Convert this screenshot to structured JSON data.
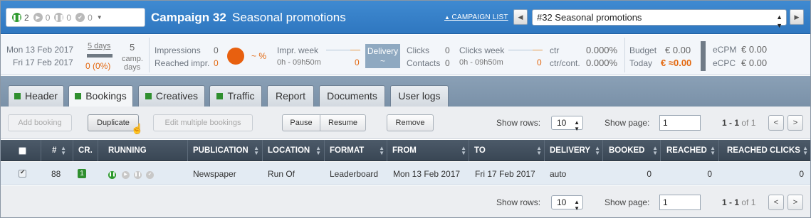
{
  "header": {
    "status_counts": [
      "2",
      "0",
      "0",
      "0"
    ],
    "title": "Campaign 32",
    "subtitle": "Seasonal promotions",
    "campaign_list_link": "CAMPAIGN LIST",
    "campaign_select": "#32 Seasonal promotions",
    "icons": {
      "running": "pause-icon",
      "play": "play-icon",
      "paused": "pause-icon",
      "done": "check-icon",
      "prev": "chevron-left-icon",
      "next": "chevron-right-icon"
    }
  },
  "info": {
    "start_date": "Mon 13 Feb 2017",
    "end_date": "Fri 17 Feb 2017",
    "days_label": "5 days",
    "days_progress": "0 (0%)",
    "camp_days_value": "5",
    "camp_days_label1": "camp.",
    "camp_days_label2": "days",
    "impressions_label": "Impressions",
    "impressions_value": "0",
    "reached_label": "Reached impr.",
    "reached_value": "0",
    "pct": "~ %",
    "impr_week_label": "Impr. week",
    "impr_week_range": "0h - 09h50m",
    "impr_week_value": "0",
    "delivery_label": "Delivery",
    "delivery_value": "~",
    "clicks_label": "Clicks",
    "clicks_value": "0",
    "contacts_label": "Contacts",
    "contacts_value": "0",
    "clicks_week_label": "Clicks week",
    "clicks_week_range": "0h - 09h50m",
    "clicks_week_value": "0",
    "ctr_label": "ctr",
    "ctr_value": "0.000%",
    "ctrcont_label": "ctr/cont.",
    "ctrcont_value": "0.000%",
    "budget_label": "Budget",
    "budget_value": "€ 0.00",
    "today_label": "Today",
    "today_value": "€ ≈0.00",
    "ecpm_label": "eCPM",
    "ecpm_value": "€ 0.00",
    "ecpc_label": "eCPC",
    "ecpc_value": "€ 0.00"
  },
  "tabs": [
    "Header",
    "Bookings",
    "Creatives",
    "Traffic",
    "Report",
    "Documents",
    "User logs"
  ],
  "toolbar": {
    "add_booking": "Add booking",
    "duplicate": "Duplicate",
    "edit_multiple": "Edit multiple bookings",
    "pause": "Pause",
    "resume": "Resume",
    "remove": "Remove",
    "show_rows_label": "Show rows:",
    "show_rows_value": "10",
    "show_page_label": "Show page:",
    "show_page_value": "1",
    "page_info_range": "1 - 1",
    "page_info_of": "of",
    "page_info_total": "1",
    "prev": "<",
    "next": ">"
  },
  "table": {
    "headers": [
      "#",
      "CR.",
      "RUNNING",
      "PUBLICATION",
      "LOCATION",
      "FORMAT",
      "FROM",
      "TO",
      "DELIVERY",
      "BOOKED",
      "REACHED",
      "REACHED CLICKS"
    ],
    "rows": [
      {
        "id": "88",
        "cr": "1",
        "publication": "Newspaper",
        "location": "Run Of",
        "format": "Leaderboard",
        "from": "Mon 13 Feb 2017",
        "to": "Fri 17 Feb 2017",
        "delivery": "auto",
        "booked": "0",
        "reached": "0",
        "reached_clicks": "0"
      }
    ]
  },
  "footer": {
    "show_rows_label": "Show rows:",
    "show_rows_value": "10",
    "show_page_label": "Show page:",
    "show_page_value": "1",
    "page_info_range": "1 - 1",
    "page_info_of": "of",
    "page_info_total": "1",
    "prev": "<",
    "next": ">"
  }
}
